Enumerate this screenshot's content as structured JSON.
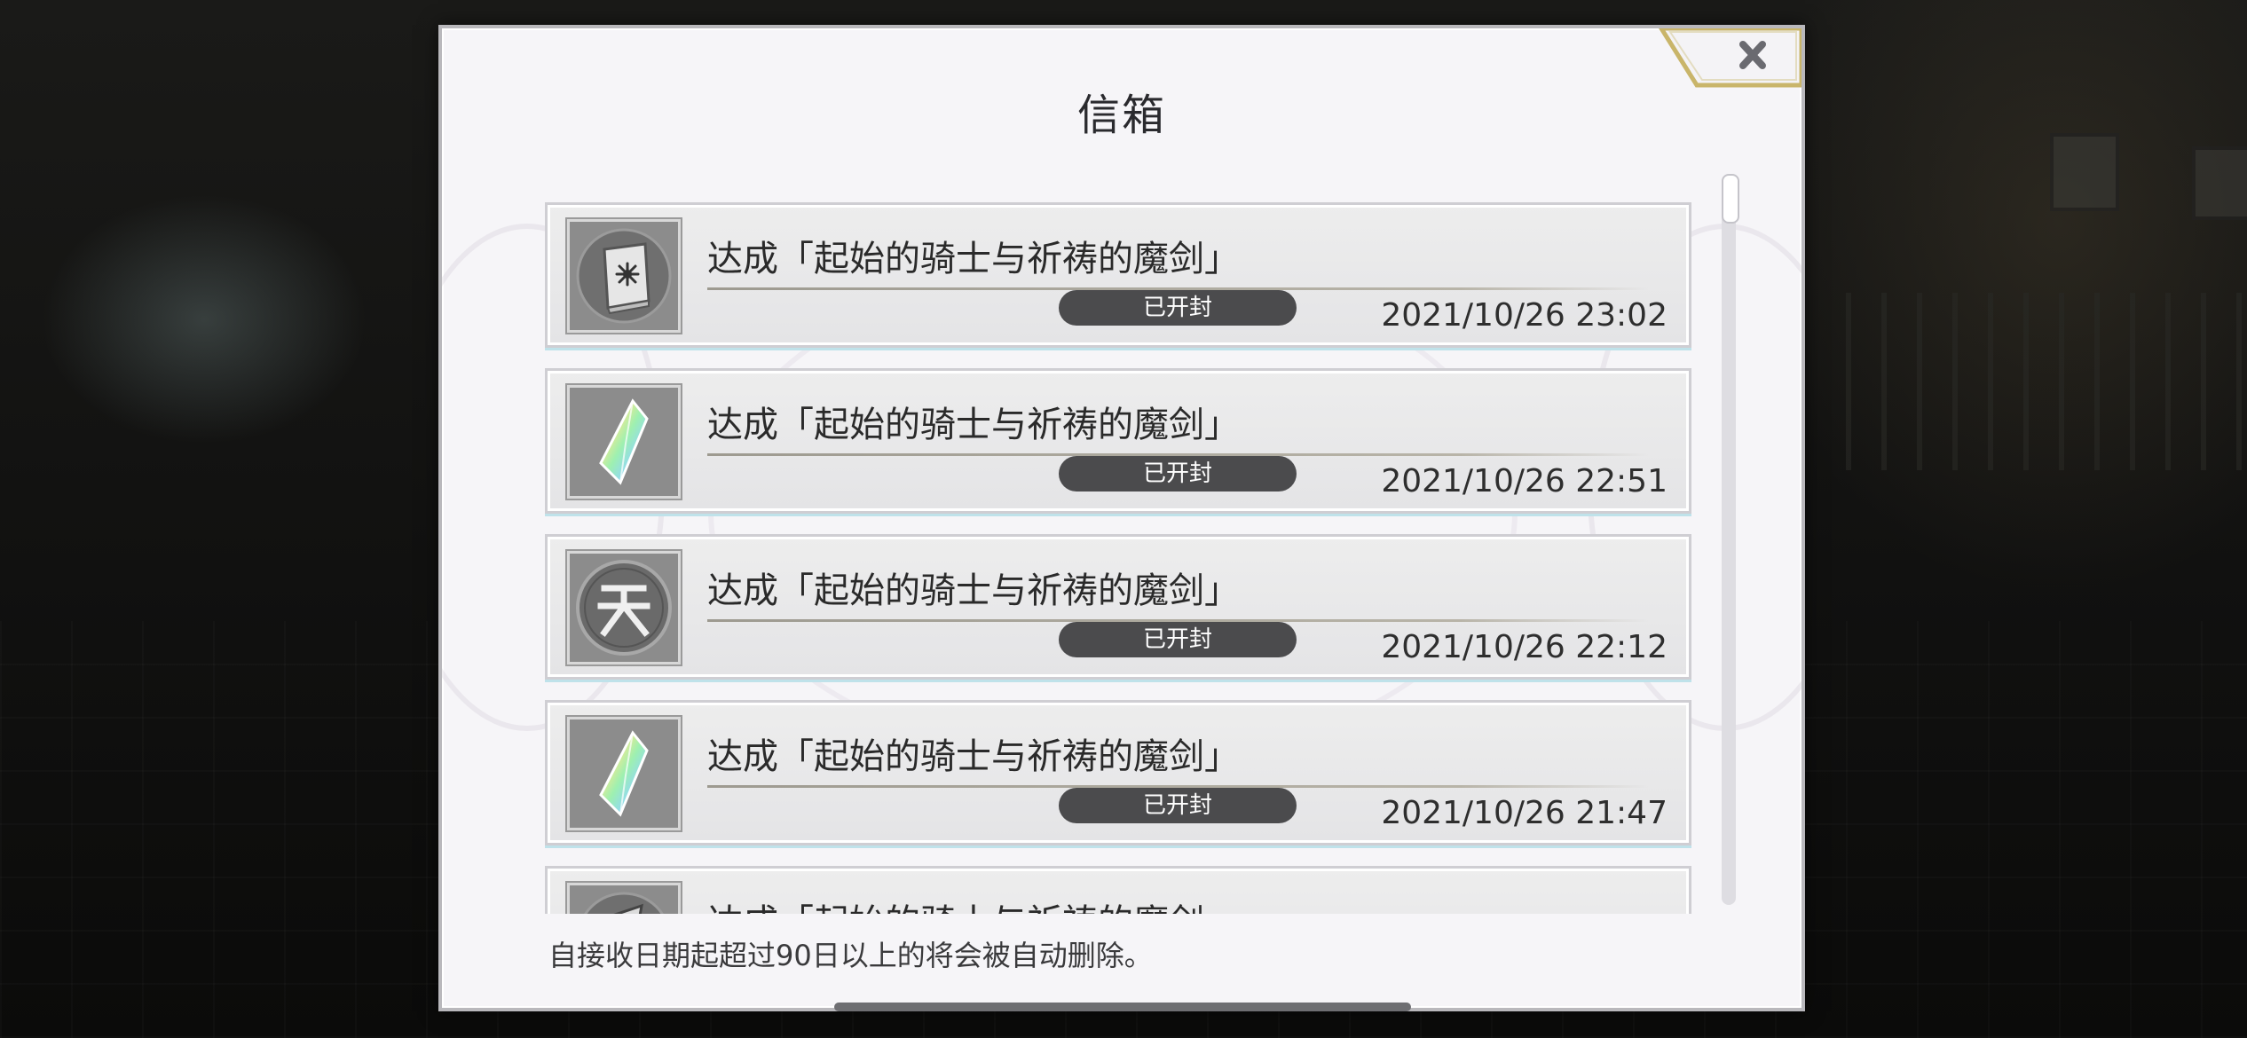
{
  "dialog": {
    "title": "信箱",
    "close_icon": "close-icon",
    "footer_note": "自接收日期起超过90日以上的将会被自动删除。"
  },
  "mail_items": [
    {
      "icon": "book-icon",
      "title": "达成「起始的骑士与祈祷的魔剑」",
      "status": "已开封",
      "date": "2021/10/26 23:02"
    },
    {
      "icon": "crystal-icon",
      "title": "达成「起始的骑士与祈祷的魔剑」",
      "status": "已开封",
      "date": "2021/10/26 22:51"
    },
    {
      "icon": "heaven-coin-icon",
      "title": "达成「起始的骑士与祈祷的魔剑」",
      "status": "已开封",
      "date": "2021/10/26 22:12"
    },
    {
      "icon": "crystal-icon",
      "title": "达成「起始的骑士与祈祷的魔剑」",
      "status": "已开封",
      "date": "2021/10/26 21:47"
    },
    {
      "icon": "item-icon",
      "title": "达成「起始的骑士与祈祷的魔剑」",
      "status": "",
      "date": ""
    }
  ],
  "colors": {
    "dialog_bg": "#f6f5f8",
    "status_badge": "#4b4b4d",
    "close_gold": "#c9b56a"
  }
}
